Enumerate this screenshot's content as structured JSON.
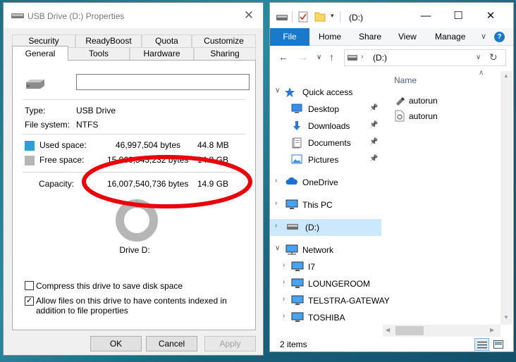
{
  "properties": {
    "title": "USB Drive (D:) Properties",
    "close_glyph": "✕",
    "tabs_top": [
      "Security",
      "ReadyBoost",
      "Quota",
      "Customize"
    ],
    "tabs_bottom": [
      "General",
      "Tools",
      "Hardware",
      "Sharing"
    ],
    "name_value": "",
    "type_label": "Type:",
    "type_value": "USB Drive",
    "fs_label": "File system:",
    "fs_value": "NTFS",
    "used_label": "Used space:",
    "used_bytes": "46,997,504 bytes",
    "used_size": "44.8 MB",
    "free_label": "Free space:",
    "free_bytes": "15,960,543,232 bytes",
    "free_size": "14.8 GB",
    "capacity_label": "Capacity:",
    "capacity_bytes": "16,007,540,736 bytes",
    "capacity_size": "14.9 GB",
    "drive_label": "Drive D:",
    "used_fraction": 0.003,
    "compress_label": "Compress this drive to save disk space",
    "compress_checked": false,
    "index_label": "Allow files on this drive to have contents indexed in addition to file properties",
    "index_checked": true,
    "ok": "OK",
    "cancel": "Cancel",
    "apply": "Apply",
    "colors": {
      "used": "#2a9fd8",
      "free": "#b6b6b6",
      "annotation": "#e8000b"
    }
  },
  "explorer": {
    "title": "(D:)",
    "ribbon": {
      "file": "File",
      "tabs": [
        "Home",
        "Share",
        "View",
        "Manage"
      ]
    },
    "address": "(D:)",
    "nav": [
      {
        "label": "Quick access",
        "icon": "star-icon"
      },
      {
        "label": "Desktop",
        "icon": "desktop-icon",
        "pinned": true
      },
      {
        "label": "Downloads",
        "icon": "download-icon",
        "pinned": true
      },
      {
        "label": "Documents",
        "icon": "documents-icon",
        "pinned": true
      },
      {
        "label": "Pictures",
        "icon": "pictures-icon",
        "pinned": true
      },
      {
        "label": "OneDrive",
        "icon": "cloud-icon"
      },
      {
        "label": "This PC",
        "icon": "pc-icon"
      },
      {
        "label": "(D:)",
        "icon": "drive-icon",
        "selected": true
      },
      {
        "label": "Network",
        "icon": "network-icon"
      },
      {
        "label": "I7",
        "icon": "monitor-icon"
      },
      {
        "label": "LOUNGEROOM",
        "icon": "monitor-icon"
      },
      {
        "label": "TELSTRA-GATEWAY",
        "icon": "monitor-icon"
      },
      {
        "label": "TOSHIBA",
        "icon": "monitor-icon"
      }
    ],
    "column_name": "Name",
    "files": [
      "autorun",
      "autorun"
    ],
    "status": "2 items",
    "accent": "#1979ca"
  }
}
